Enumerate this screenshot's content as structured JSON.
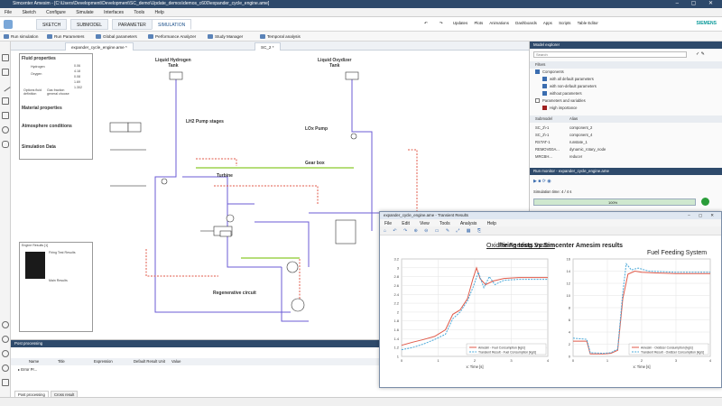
{
  "window": {
    "title": "Simcenter Amesim - [C:\\Users\\Development\\Development\\SC_demo\\Update_demos\\demos_c600\\expander_cycle_engine.ame]",
    "controls": "– ▢ ✕"
  },
  "menu": [
    "File",
    "Sketch",
    "Configure",
    "Simulate",
    "Interfaces",
    "Tools",
    "Help"
  ],
  "ribbon": {
    "tabs": [
      "SKETCH",
      "SUBMODEL",
      "PARAMETER",
      "SIMULATION"
    ],
    "active_tab": "SIMULATION",
    "brand": "SIEMENS",
    "right_items": [
      "Updates",
      "Plots",
      "Animations",
      "Dashboards",
      "Apps",
      "Scripts",
      "Table Editor"
    ]
  },
  "toolbar": {
    "items": [
      "Run simulation",
      "Run Parameters",
      "Global parameters",
      "Performance Analyzer",
      "Study Manager",
      "Temporal analysis"
    ]
  },
  "doc_tabs": [
    "expander_cycle_engine.ame *",
    "SC_2 *"
  ],
  "canvas": {
    "labels": {
      "lh2_tank": "Liquid Hydrogen\nTank",
      "lox_tank": "Liquid Oxydizer\nTank",
      "lh2_pump": "LH2 Pump stages",
      "lox_pump": "LOx Pump",
      "gearbox": "Gear box",
      "turbine": "Turbine",
      "regen": "Regenerative circuit"
    },
    "sidebar": {
      "fluid": "Fluid properties",
      "material": "Material properties",
      "atmosphere": "Atmosphere conditions",
      "simulation": "Simulation Data",
      "fluid_rows": [
        "Hydrogen",
        "Oxygen"
      ],
      "fluid_values": [
        "0.06",
        "4.18",
        "0.08",
        "1.69",
        "1.302"
      ],
      "defs": [
        "Options fluid definition",
        "Gas fraction general choose"
      ]
    },
    "engine_results": {
      "title": "Engine Results [1]",
      "firing": "Firing Test Results",
      "main": "Main Results"
    }
  },
  "model_explorer": {
    "title": "Model explorer",
    "search": "Search",
    "filters_title": "Filters",
    "filters": [
      "Components",
      "with all default parameters",
      "with non-default parameters",
      "without parameters",
      "Parameters and variables",
      "High importance"
    ],
    "submodel_header": [
      "Submodel",
      "Alias"
    ],
    "submodels": [
      {
        "name": "SC_2\\-1",
        "alias": "component_2"
      },
      {
        "name": "SC_2\\-1",
        "alias": "component_4"
      },
      {
        "name": "RSTAT-1",
        "alias": "runstate_1"
      },
      {
        "name": "REMOVE0A...",
        "alias": "dynamic_rotary_node"
      },
      {
        "name": "MRCBH...",
        "alias": "reducer"
      }
    ]
  },
  "run_monitor": {
    "title": "Run monitor - expander_cycle_engine.ame",
    "sim_time": "Simulation time: 4 / 4 s",
    "progress_pct": 100,
    "progress_label": "100%"
  },
  "post": {
    "title": "Post processing",
    "columns": [
      "Name",
      "Title",
      "Expression",
      "Default Result Unit",
      "Value"
    ],
    "row": "Error Pr...",
    "tabs": [
      "Post processing",
      "Cross result"
    ]
  },
  "transient": {
    "title": "expander_cycle_engine.ame - Transient Results",
    "controls": "– ▢ ✕",
    "menu": [
      "File",
      "Edit",
      "View",
      "Tools",
      "Analysis",
      "Help"
    ],
    "heading_left": "Oxidize Feeding System",
    "heading_center": "Firing tests vs Simcenter Amesim results",
    "heading_right": "Fuel Feeding System",
    "colors": {
      "amesim": "#e05a4a",
      "test": "#4aa8d8"
    }
  },
  "chart_data": [
    {
      "type": "line",
      "title": "Oxidize Feeding System",
      "xlabel": "x: Time [s]",
      "xlim": [
        0,
        4
      ],
      "ylim": [
        1.0,
        3.2
      ],
      "xticks": [
        0,
        1,
        2,
        3,
        4
      ],
      "yticks": [
        1.0,
        1.2,
        1.4,
        1.6,
        1.8,
        2.0,
        2.2,
        2.4,
        2.6,
        2.8,
        3.0,
        3.2
      ],
      "legend": "bottom-right",
      "series": [
        {
          "name": "Amesim - Fuel Consumption [kg/s]",
          "x": [
            0,
            0.3,
            0.6,
            0.9,
            1.2,
            1.4,
            1.6,
            1.8,
            1.95,
            2.05,
            2.15,
            2.3,
            2.5,
            2.8,
            3.2,
            3.6,
            4.0
          ],
          "y": [
            1.25,
            1.32,
            1.38,
            1.45,
            1.6,
            1.95,
            2.05,
            2.3,
            2.75,
            3.0,
            2.75,
            2.62,
            2.7,
            2.76,
            2.78,
            2.78,
            2.78
          ]
        },
        {
          "name": "Transient Result - Fuel Consumption [kg/s]",
          "x": [
            0,
            0.3,
            0.6,
            0.9,
            1.2,
            1.4,
            1.6,
            1.8,
            1.95,
            2.1,
            2.25,
            2.4,
            2.55,
            2.8,
            3.2,
            3.6,
            4.0
          ],
          "y": [
            1.15,
            1.2,
            1.28,
            1.38,
            1.5,
            1.85,
            2.0,
            2.25,
            2.55,
            2.9,
            2.55,
            2.8,
            2.62,
            2.72,
            2.74,
            2.74,
            2.74
          ]
        }
      ]
    },
    {
      "type": "line",
      "title": "Fuel Feeding System",
      "xlabel": "x: Time [s]",
      "xlim": [
        0,
        4
      ],
      "ylim": [
        0,
        16
      ],
      "xticks": [
        0,
        1,
        2,
        3,
        4
      ],
      "yticks": [
        0,
        2,
        4,
        6,
        8,
        10,
        12,
        14,
        16
      ],
      "legend": "bottom-right",
      "series": [
        {
          "name": "Amesim - Oxidizer Consumption [kg/s]",
          "x": [
            0,
            0.4,
            0.5,
            0.9,
            1.1,
            1.3,
            1.45,
            1.6,
            1.8,
            2.0,
            2.4,
            3.0,
            4.0
          ],
          "y": [
            2.5,
            2.5,
            0.4,
            0.4,
            0.5,
            1.0,
            9.5,
            13.5,
            14.0,
            13.8,
            13.7,
            13.6,
            13.6
          ]
        },
        {
          "name": "Transient Result - Oxidizer Consumption [kg/s]",
          "x": [
            0,
            0.4,
            0.5,
            0.9,
            1.1,
            1.3,
            1.45,
            1.55,
            1.7,
            1.9,
            2.2,
            3.0,
            4.0
          ],
          "y": [
            3.0,
            2.8,
            0.6,
            0.5,
            0.6,
            1.2,
            10.5,
            15.2,
            14.2,
            14.5,
            14.0,
            13.8,
            13.8
          ]
        }
      ]
    }
  ],
  "status": ""
}
